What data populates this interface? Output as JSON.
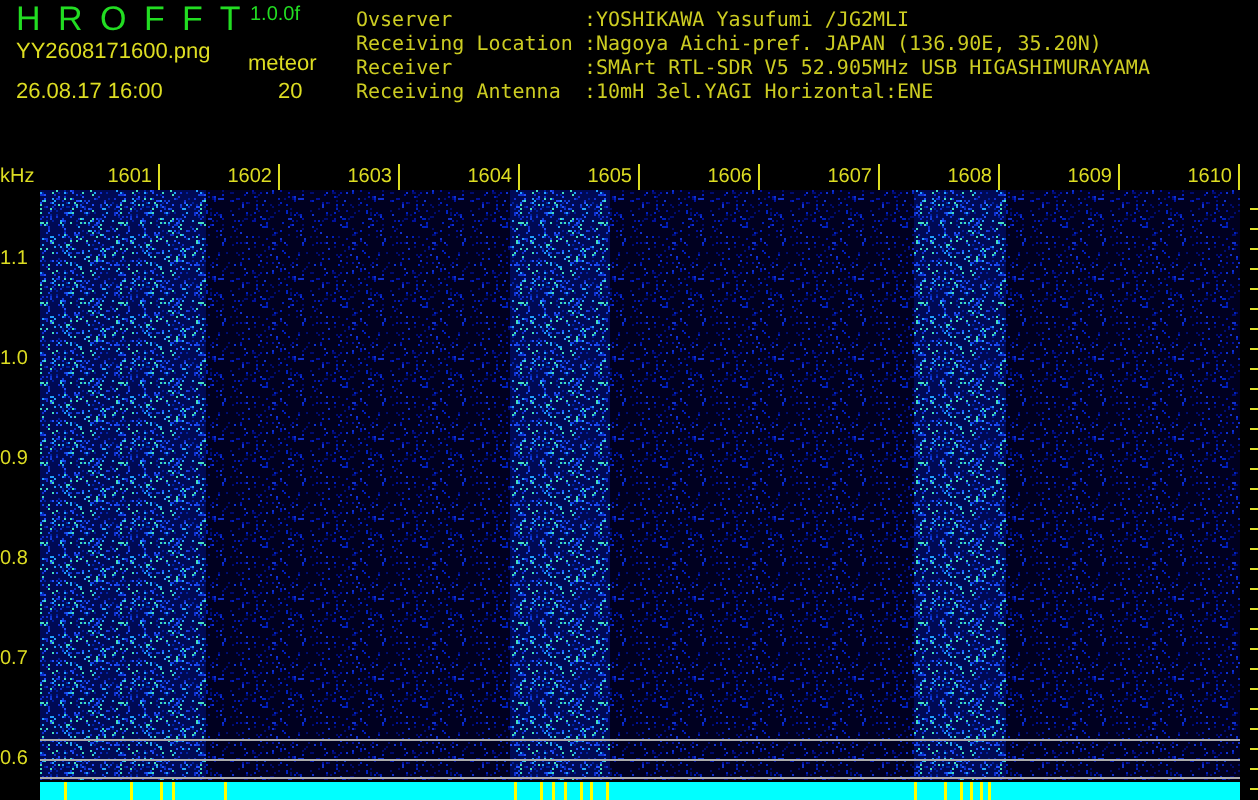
{
  "header": {
    "title": "H R O F F T",
    "version": "1.0.0f",
    "filename": "YY2608171600.png",
    "datetime": "26.08.17 16:00",
    "meteor_label": "meteor",
    "meteor_count": "20"
  },
  "info": [
    {
      "label": "Ovserver",
      "value": ":YOSHIKAWA Yasufumi /JG2MLI"
    },
    {
      "label": "Receiving Location",
      "value": ":Nagoya Aichi-pref. JAPAN (136.90E, 35.20N)"
    },
    {
      "label": "Receiver",
      "value": ":SMArt RTL-SDR V5 52.905MHz USB HIGASHIMURAYAMA"
    },
    {
      "label": "Receiving Antenna",
      "value": ":10mH 3el.YAGI Horizontal:ENE"
    }
  ],
  "chart": {
    "unit": "kHz",
    "x_labels": [
      "1601",
      "1602",
      "1603",
      "1604",
      "1605",
      "1606",
      "1607",
      "1608",
      "1609",
      "1610"
    ],
    "y_labels": [
      "1.1",
      "1.0",
      "0.9",
      "0.8",
      "0.7",
      "0.6"
    ]
  }
}
